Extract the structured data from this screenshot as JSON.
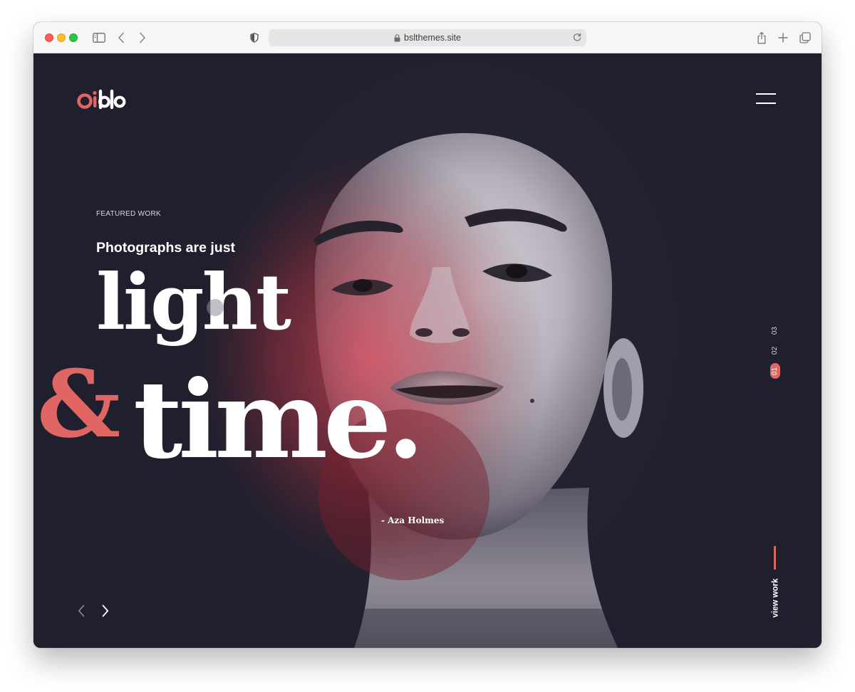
{
  "browser": {
    "url": "bslthemes.site",
    "icons": [
      "sidebar-icon",
      "chevron-left-icon",
      "chevron-right-icon",
      "shield-icon",
      "lock-icon",
      "reload-icon",
      "share-icon",
      "plus-icon",
      "tabs-icon"
    ]
  },
  "site": {
    "logo_text": "oiblo",
    "eyebrow": "FEATURED WORK",
    "subtitle": "Photographs are just",
    "headline_word_1": "light",
    "ampersand": "&",
    "headline_word_2": "time",
    "headline_period": ".",
    "author": "- Aza Holmes",
    "slides": [
      "03",
      "02",
      "01"
    ],
    "active_slide": "01",
    "view_work": "view work"
  },
  "colors": {
    "accent": "#e06664",
    "background": "#1f1f2e",
    "text": "#ffffff"
  }
}
